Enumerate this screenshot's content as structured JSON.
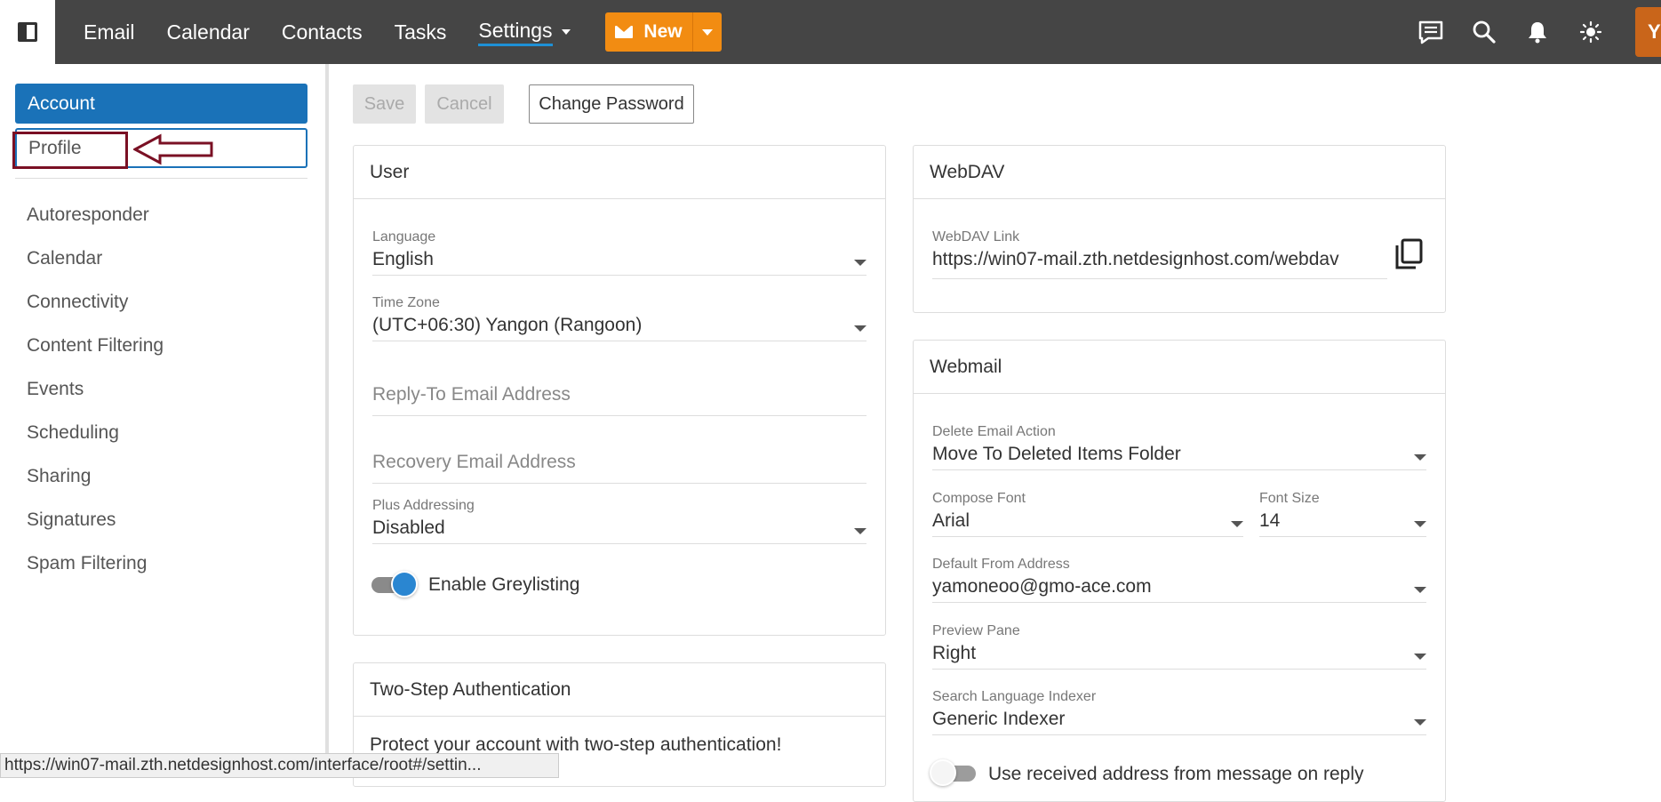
{
  "topbar": {
    "nav": [
      "Email",
      "Calendar",
      "Contacts",
      "Tasks"
    ],
    "settings_label": "Settings",
    "new_label": "New",
    "avatar_initial": "Y"
  },
  "sidebar": {
    "account_label": "Account",
    "profile_label": "Profile",
    "items": [
      "Autoresponder",
      "Calendar",
      "Connectivity",
      "Content Filtering",
      "Events",
      "Scheduling",
      "Sharing",
      "Signatures",
      "Spam Filtering"
    ]
  },
  "toolbar": {
    "save_label": "Save",
    "cancel_label": "Cancel",
    "change_password_label": "Change Password"
  },
  "user_card": {
    "title": "User",
    "language_label": "Language",
    "language_value": "English",
    "timezone_label": "Time Zone",
    "timezone_value": "(UTC+06:30) Yangon (Rangoon)",
    "reply_to_placeholder": "Reply-To Email Address",
    "recovery_placeholder": "Recovery Email Address",
    "plus_label": "Plus Addressing",
    "plus_value": "Disabled",
    "greylisting_label": "Enable Greylisting",
    "greylisting_on": true
  },
  "twostep_card": {
    "title": "Two-Step Authentication",
    "text": "Protect your account with two-step authentication!"
  },
  "webdav_card": {
    "title": "WebDAV",
    "link_label": "WebDAV Link",
    "link_value": "https://win07-mail.zth.netdesignhost.com/webdav"
  },
  "webmail_card": {
    "title": "Webmail",
    "delete_label": "Delete Email Action",
    "delete_value": "Move To Deleted Items Folder",
    "font_label": "Compose Font",
    "font_value": "Arial",
    "size_label": "Font Size",
    "size_value": "14",
    "from_label": "Default From Address",
    "from_value": "yamoneoo@gmo-ace.com",
    "preview_label": "Preview Pane",
    "preview_value": "Right",
    "indexer_label": "Search Language Indexer",
    "indexer_value": "Generic Indexer",
    "reply_toggle_label": "Use received address from message on reply"
  },
  "status_url": "https://win07-mail.zth.netdesignhost.com/interface/root#/settin..."
}
